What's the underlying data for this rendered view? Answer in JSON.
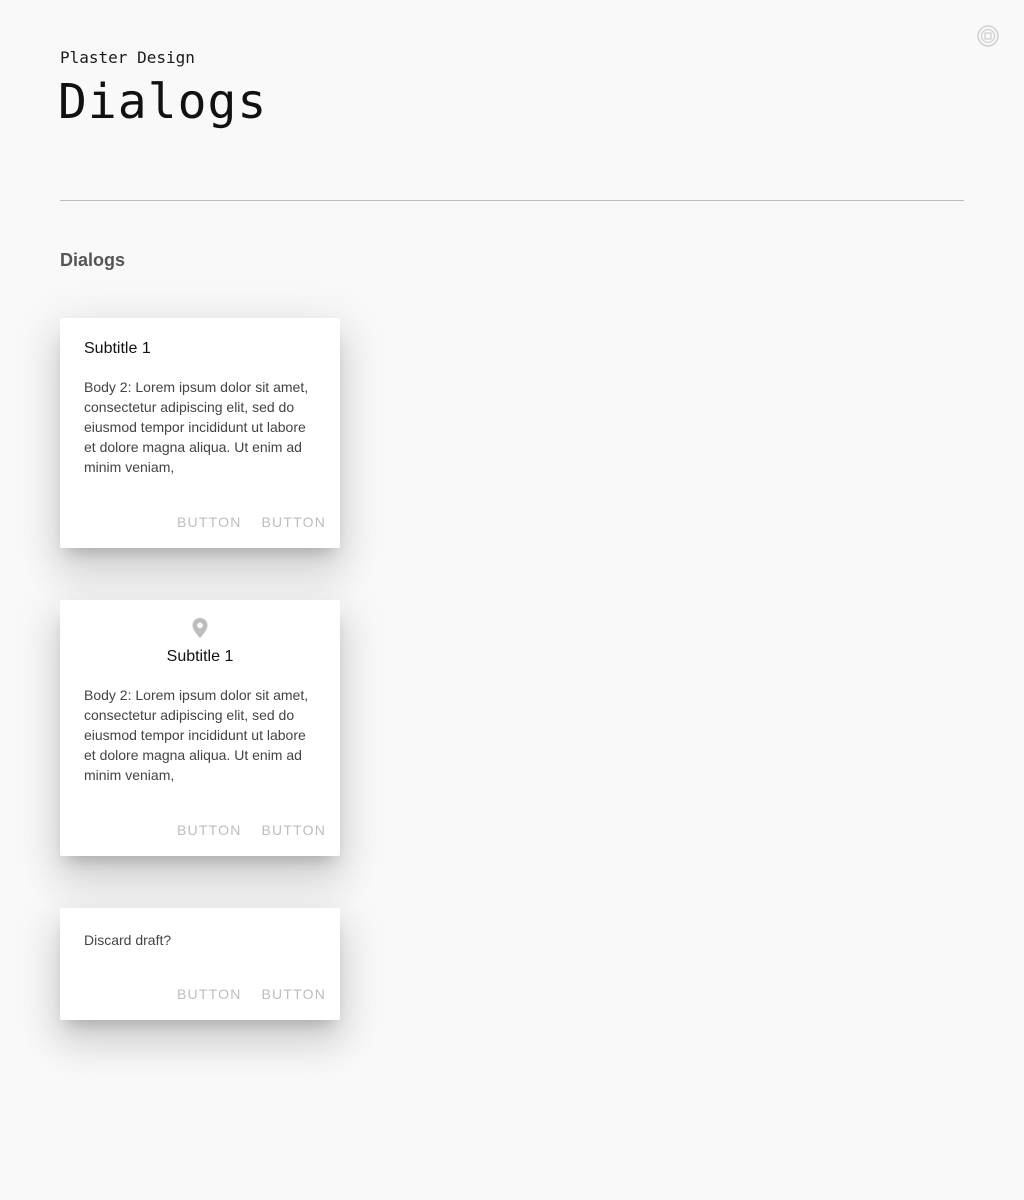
{
  "header": {
    "brand": "Plaster Design",
    "title": "Dialogs"
  },
  "section": {
    "heading": "Dialogs"
  },
  "dialogs": [
    {
      "title": "Subtitle 1",
      "body": "Body 2: Lorem ipsum dolor sit amet, consectetur adipiscing elit, sed do eiusmod tempor incididunt ut labore et dolore magna aliqua. Ut enim ad minim veniam,",
      "buttons": [
        "BUTTON",
        "BUTTON"
      ]
    },
    {
      "icon": "location-pin-icon",
      "title": "Subtitle 1",
      "body": "Body 2: Lorem ipsum dolor sit amet, consectetur adipiscing elit, sed do eiusmod tempor incididunt ut labore et dolore magna aliqua. Ut enim ad minim veniam,",
      "buttons": [
        "BUTTON",
        "BUTTON"
      ]
    },
    {
      "body": "Discard draft?",
      "buttons": [
        "BUTTON",
        "BUTTON"
      ]
    }
  ],
  "icons": {
    "corner": "settings-circle-icon"
  },
  "colors": {
    "background": "#f9f9f9",
    "button_text": "#bdbdbd",
    "icon": "#bdbdbd"
  }
}
